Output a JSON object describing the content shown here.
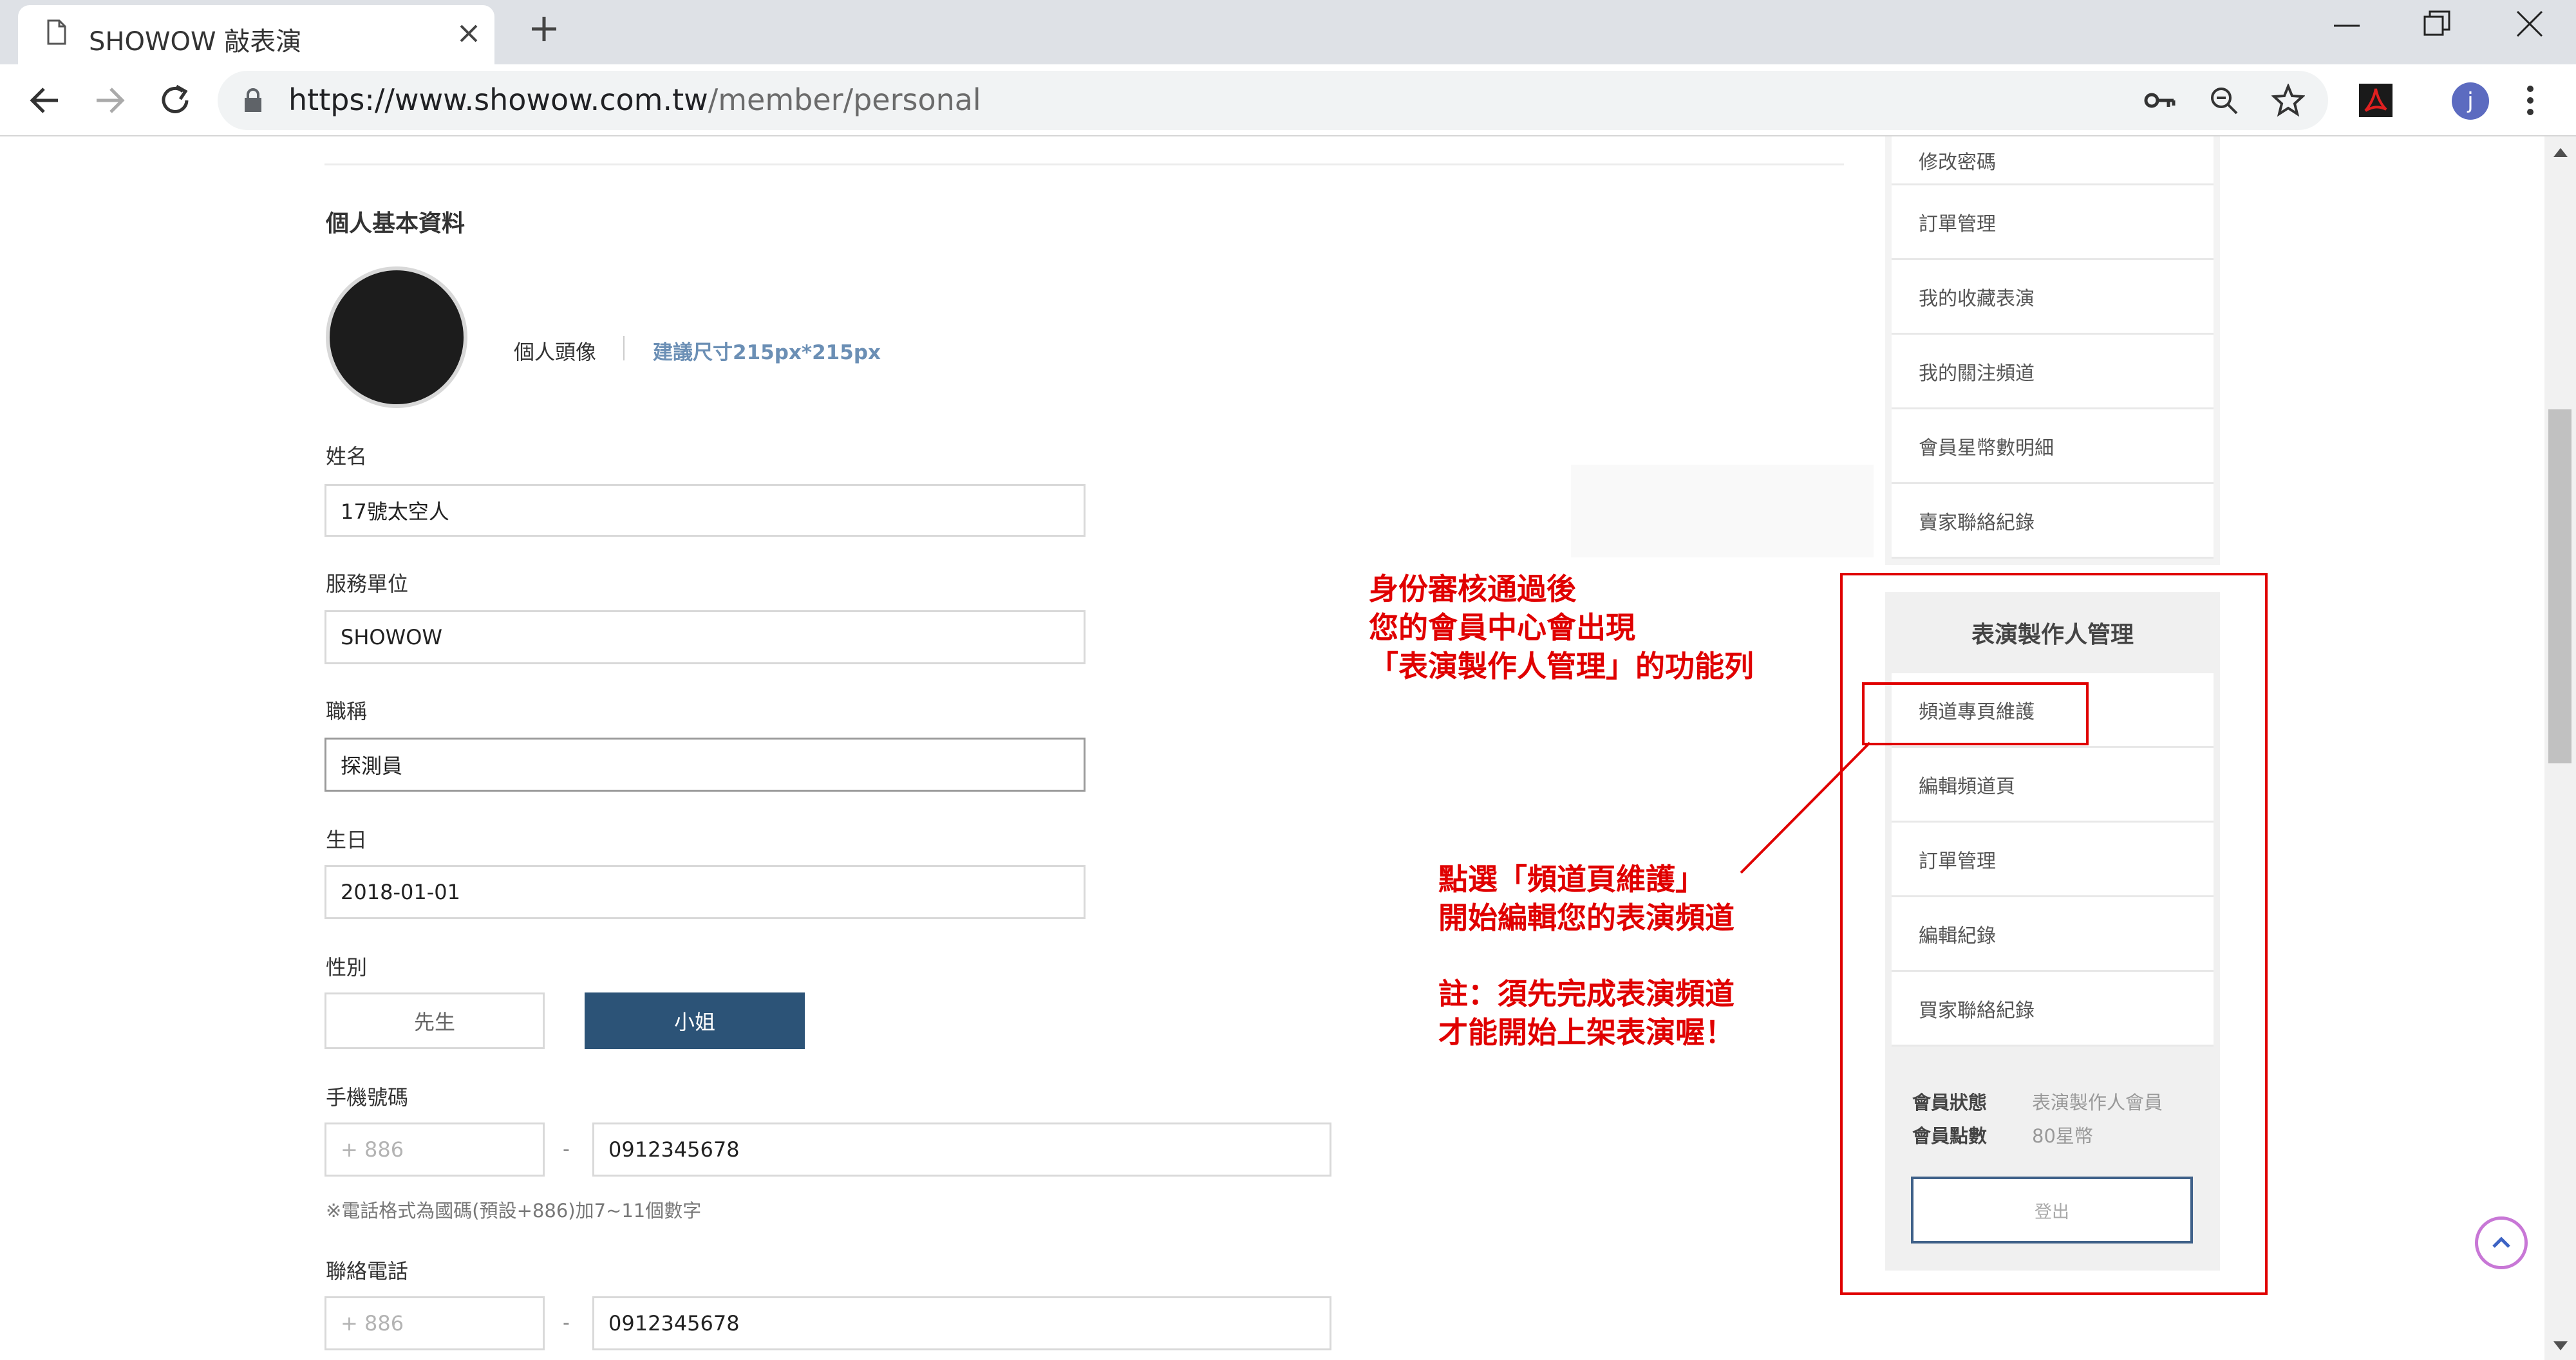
{
  "browser": {
    "tab_title": "SHOWOW 敲表演",
    "url_host": "https://www.showow.com.tw",
    "url_path": "/member/personal",
    "avatar_letter": "j"
  },
  "profile": {
    "section_title": "個人基本資料",
    "avatar_label": "個人頭像",
    "avatar_hint": "建議尺寸215px*215px",
    "name_label": "姓名",
    "name_value": "17號太空人",
    "org_label": "服務單位",
    "org_value": "SHOWOW",
    "title_label": "職稱",
    "title_value": "探測員",
    "birth_label": "生日",
    "birth_value": "2018-01-01",
    "gender_label": "性別",
    "gender_options": [
      "先生",
      "小姐"
    ],
    "gender_selected": "小姐",
    "mobile_label": "手機號碼",
    "mobile_code_placeholder": "+ 886",
    "mobile_value": "0912345678",
    "mobile_hint": "※電話格式為國碼(預設+886)加7~11個數字",
    "phone_label": "聯絡電話",
    "phone_code_placeholder": "+ 886",
    "phone_value": "0912345678",
    "dash": "-"
  },
  "member_menu": {
    "items": [
      "修改密碼",
      "訂單管理",
      "我的收藏表演",
      "我的關注頻道",
      "會員星幣數明細",
      "賣家聯絡紀錄"
    ]
  },
  "producer_menu": {
    "header": "表演製作人管理",
    "items": [
      "頻道專頁維護",
      "編輯頻道頁",
      "訂單管理",
      "編輯紀錄",
      "買家聯絡紀錄"
    ]
  },
  "member_info": {
    "status_label": "會員狀態",
    "status_value": "表演製作人會員",
    "points_label": "會員點數",
    "points_value": "80星幣",
    "logout_label": "登出"
  },
  "annotations": {
    "note1": [
      "身份審核通過後",
      "您的會員中心會出現",
      "「表演製作人管理」的功能列"
    ],
    "note2": [
      "點選「頻道頁維護」",
      "開始編輯您的表演頻道"
    ],
    "note3": [
      "註：須先完成表演頻道",
      "才能開始上架表演喔！"
    ]
  },
  "colors": {
    "selected_gender": "#2c5377",
    "annotation_red": "#e00000",
    "link_blue": "#6b8fb5",
    "chrome_bg": "#dee1e6"
  }
}
